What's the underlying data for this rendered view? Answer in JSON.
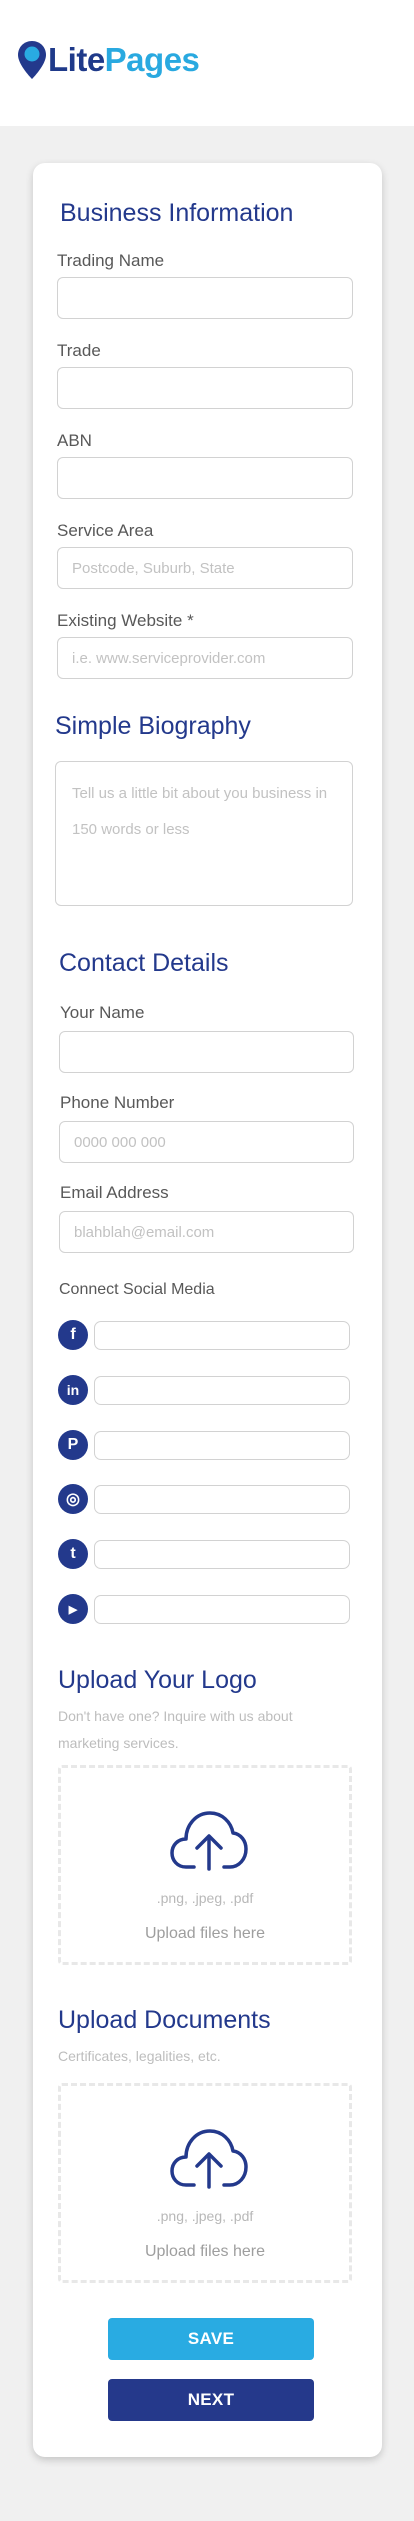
{
  "brand": {
    "name_part1": "Lite",
    "name_part2": "Pages",
    "primary": "#23398c",
    "accent": "#29abe2"
  },
  "business": {
    "title": "Business Information",
    "fields": [
      {
        "label": "Trading Name",
        "placeholder": "",
        "value": ""
      },
      {
        "label": "Trade",
        "placeholder": "",
        "value": ""
      },
      {
        "label": "ABN",
        "placeholder": "",
        "value": ""
      },
      {
        "label": "Service Area",
        "placeholder": "Postcode, Suburb, State",
        "value": ""
      },
      {
        "label": "Existing Website *",
        "placeholder": "i.e. www.serviceprovider.com",
        "value": ""
      }
    ]
  },
  "biography": {
    "title": "Simple Biography",
    "placeholder": "Tell us a little bit about you business in 150 words or less"
  },
  "contact": {
    "title": "Contact Details",
    "fields": [
      {
        "label": "Your Name",
        "placeholder": "",
        "value": ""
      },
      {
        "label": "Phone Number",
        "placeholder": "0000 000 000",
        "value": ""
      },
      {
        "label": "Email Address",
        "placeholder": "blahblah@email.com",
        "value": ""
      }
    ],
    "social_label": "Connect Social Media",
    "social": [
      {
        "icon": "facebook-icon",
        "glyph": "f"
      },
      {
        "icon": "linkedin-icon",
        "glyph": "in"
      },
      {
        "icon": "pinterest-icon",
        "glyph": "P"
      },
      {
        "icon": "instagram-icon",
        "glyph": "◎"
      },
      {
        "icon": "twitter-icon",
        "glyph": "t"
      },
      {
        "icon": "youtube-icon",
        "glyph": "▶"
      }
    ]
  },
  "logo_upload": {
    "title": "Upload Your Logo",
    "subtitle": "Don't have one? Inquire with us about marketing services.",
    "types": ".png, .jpeg, .pdf",
    "hint": "Upload files here"
  },
  "documents_upload": {
    "title": "Upload Documents",
    "subtitle": "Certificates, legalities, etc.",
    "types": ".png, .jpeg, .pdf",
    "hint": "Upload files here"
  },
  "actions": {
    "save_label": "SAVE",
    "next_label": "NEXT"
  }
}
